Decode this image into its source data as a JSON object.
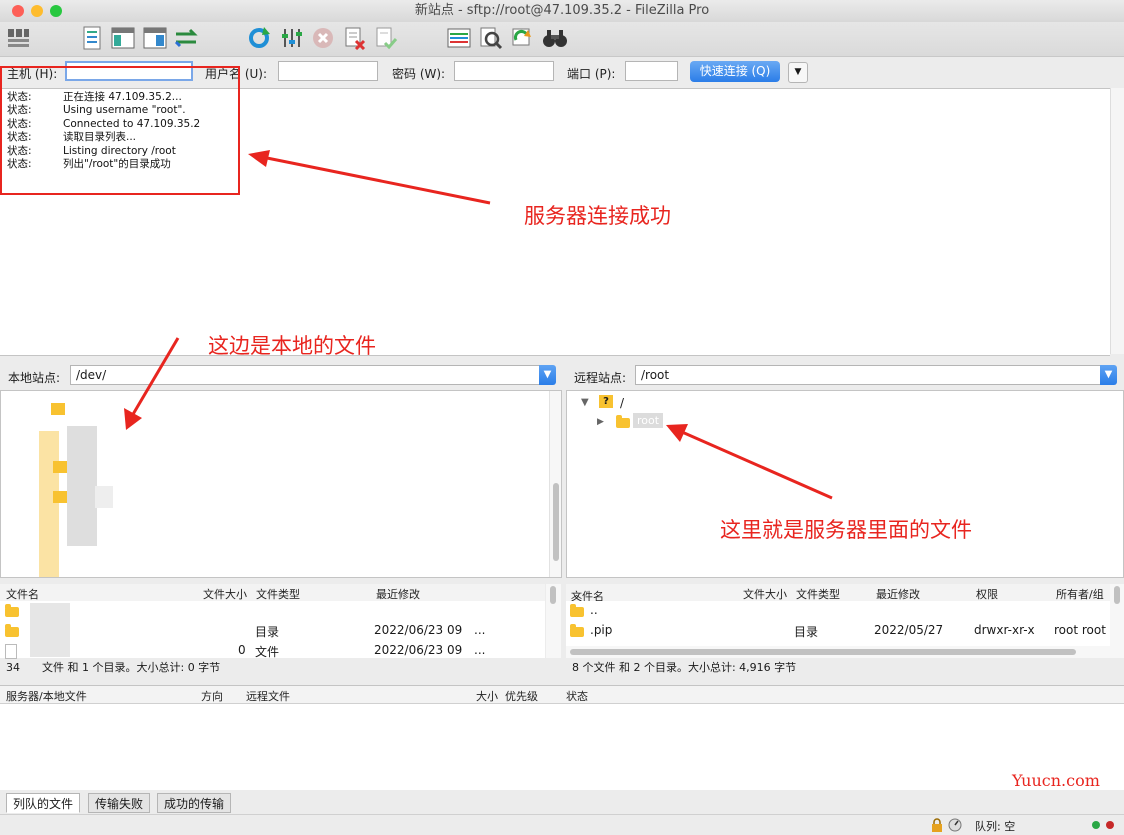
{
  "window": {
    "title": "新站点 - sftp://root@47.109.35.2 - FileZilla Pro"
  },
  "toolbar": {
    "icons": [
      "site-manager-icon",
      "message-log-icon",
      "local-tree-icon",
      "remote-tree-icon",
      "transfer-queue-icon",
      "refresh-icon",
      "process-queue-icon",
      "cancel-icon",
      "disconnect-icon",
      "reconnect-icon",
      "filter-icon",
      "compare-icon",
      "sync-browse-icon",
      "search-icon"
    ]
  },
  "quickconnect": {
    "host_label": "主机 (H):",
    "host_value": "",
    "user_label": "用户名 (U):",
    "password_label": "密码 (W):",
    "port_label": "端口 (P):",
    "button_label": "快速连接 (Q)",
    "button_color": "#2a7de8"
  },
  "log": {
    "lines": [
      {
        "key": "状态:",
        "text": "正在连接 47.109.35.2..."
      },
      {
        "key": "状态:",
        "text": "Using username \"root\"."
      },
      {
        "key": "状态:",
        "text": "Connected to 47.109.35.2"
      },
      {
        "key": "状态:",
        "text": "读取目录列表..."
      },
      {
        "key": "状态:",
        "text": "Listing directory /root"
      },
      {
        "key": "状态:",
        "text": "列出\"/root\"的目录成功"
      }
    ]
  },
  "local": {
    "site_label": "本地站点:",
    "path": "/dev/",
    "columns": [
      "文件名",
      "文件大小",
      "文件类型",
      "最近修改"
    ],
    "rows": [
      {
        "size": "",
        "type": "目录",
        "modified": "2022/06/23 09",
        "more": "..."
      },
      {
        "size": "0",
        "type": "文件",
        "modified": "2022/06/23 09",
        "more": "..."
      }
    ],
    "status_prefix": "34",
    "status": "文件 和 1 个目录。大小总计: 0 字节"
  },
  "remote": {
    "site_label": "远程站点:",
    "path": "/root",
    "tree_root": "/",
    "tree_child": "root",
    "columns": [
      "文件名",
      "文件大小",
      "文件类型",
      "最近修改",
      "权限",
      "所有者/组"
    ],
    "rows": [
      {
        "name": "..",
        "size": "",
        "type": "",
        "modified": "",
        "perms": "",
        "owner": ""
      },
      {
        "name": ".pip",
        "size": "",
        "type": "目录",
        "modified": "2022/05/27",
        "perms": "drwxr-xr-x",
        "owner": "root root"
      }
    ],
    "status": "8 个文件 和 2 个目录。大小总计: 4,916 字节"
  },
  "queue": {
    "columns": [
      "服务器/本地文件",
      "方向",
      "远程文件",
      "大小",
      "优先级",
      "状态"
    ],
    "tabs": [
      "列队的文件",
      "传输失败",
      "成功的传输"
    ],
    "status_label": "队列: 空"
  },
  "annotations": {
    "connect_success": "服务器连接成功",
    "local_files": "这边是本地的文件",
    "server_files": "这里就是服务器里面的文件",
    "color": "#e8251f"
  },
  "watermark": "Yuucn.com"
}
